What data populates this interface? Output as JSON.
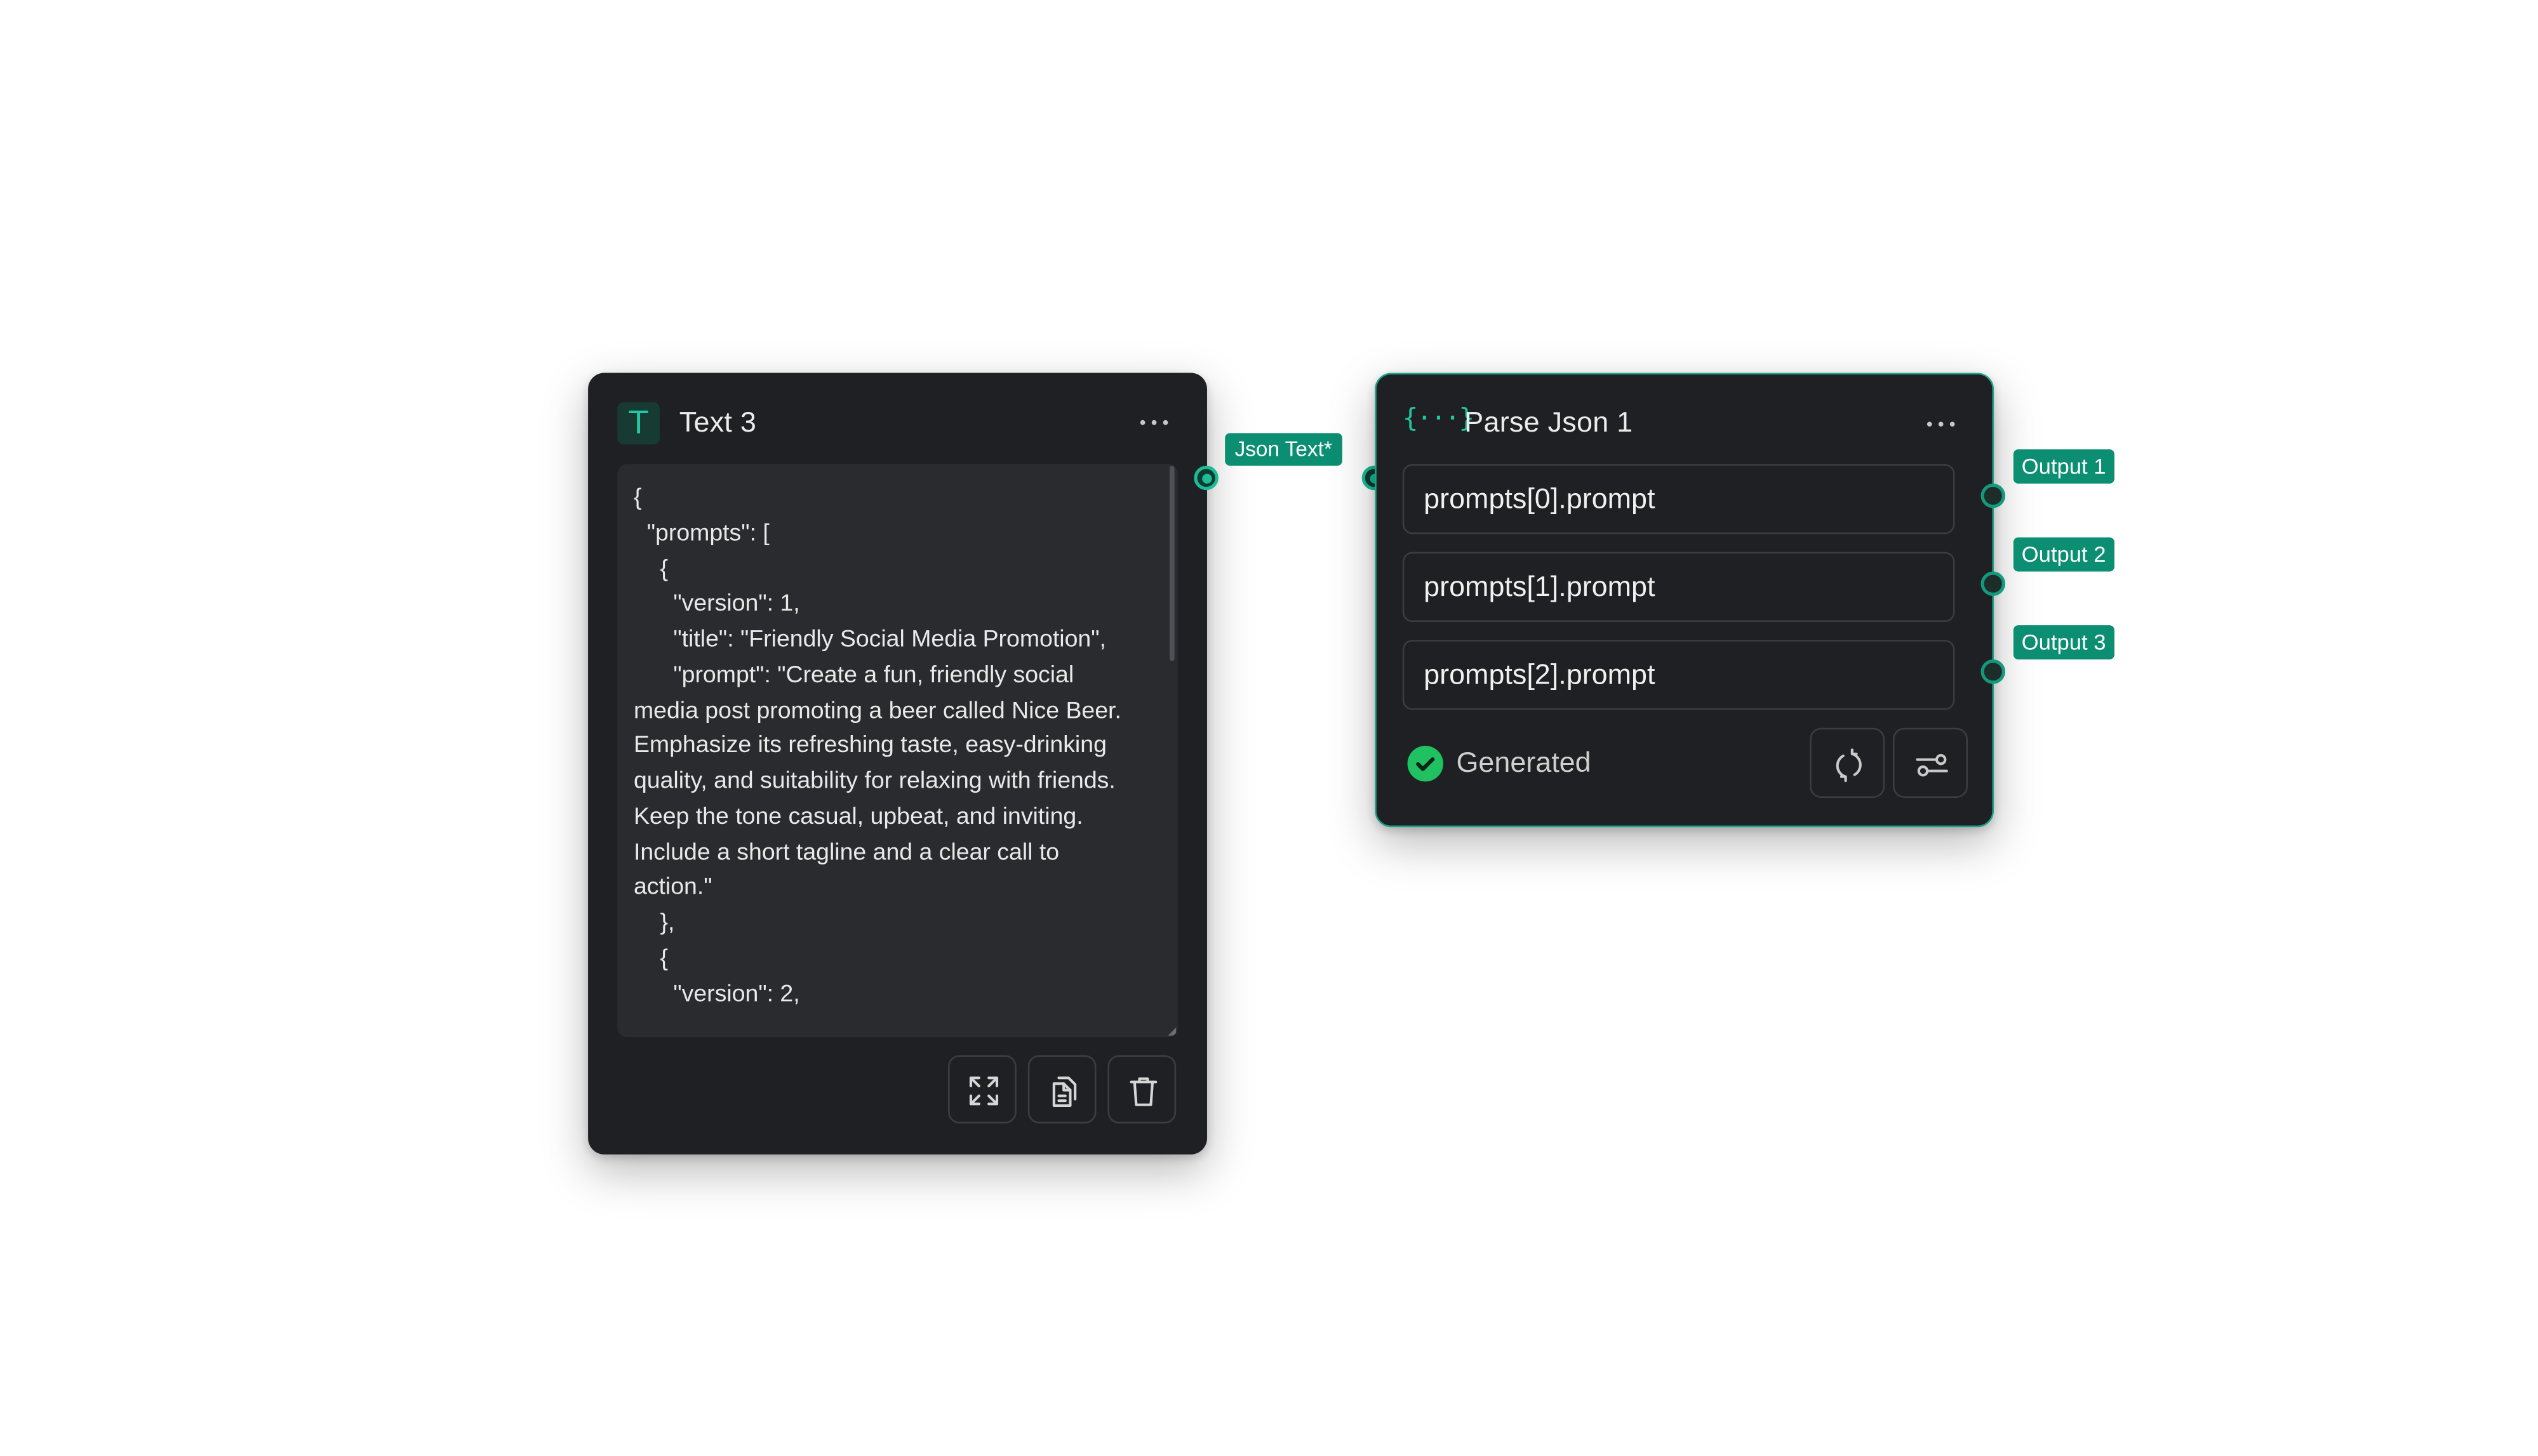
{
  "text_node": {
    "title": "Text 3",
    "icon": "text-t-icon",
    "menu_icon": "more-horizontal-icon",
    "content": "{\n  \"prompts\": [\n    {\n      \"version\": 1,\n      \"title\": \"Friendly Social Media Promotion\",\n      \"prompt\": \"Create a fun, friendly social media post promoting a beer called Nice Beer. Emphasize its refreshing taste, easy-drinking quality, and suitability for relaxing with friends. Keep the tone casual, upbeat, and inviting. Include a short tagline and a clear call to action.\"\n    },\n    {\n      \"version\": 2,",
    "toolbar": [
      "expand-icon",
      "copy-document-icon",
      "trash-icon"
    ]
  },
  "connection": {
    "label": "Json Text*"
  },
  "parse_node": {
    "title": "Parse Json 1",
    "icon": "json-braces-icon",
    "icon_glyph": "{···}",
    "menu_icon": "more-horizontal-icon",
    "fields": [
      "prompts[0].prompt",
      "prompts[1].prompt",
      "prompts[2].prompt"
    ],
    "status": "Generated",
    "status_icon": "check-circle-icon",
    "status_color": "#1fc160",
    "buttons": [
      "refresh-icon",
      "settings-sliders-icon"
    ]
  },
  "outputs": [
    "Output 1",
    "Output 2",
    "Output 3"
  ],
  "colors": {
    "accent": "#0c8e72",
    "node_background": "#1f2023",
    "selected_border": "#1ba486"
  }
}
